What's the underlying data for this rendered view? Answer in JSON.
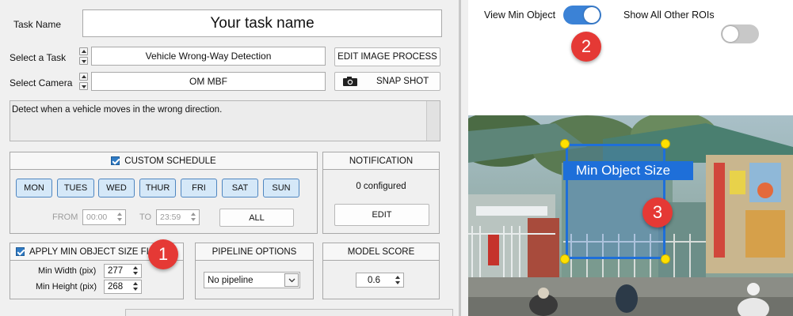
{
  "task": {
    "name_label": "Task Name",
    "name_value": "Your task name",
    "select_task_label": "Select a Task",
    "select_task_value": "Vehicle Wrong-Way Detection",
    "select_camera_label": "Select Camera",
    "select_camera_value": "OM MBF",
    "edit_image_process_label": "EDIT IMAGE PROCESS",
    "snapshot_label": "SNAP SHOT",
    "description": "Detect when a vehicle moves in the wrong direction."
  },
  "schedule": {
    "title": "CUSTOM SCHEDULE",
    "days": [
      "MON",
      "TUES",
      "WED",
      "THUR",
      "FRI",
      "SAT",
      "SUN"
    ],
    "from_label": "FROM",
    "from_value": "00:00",
    "to_label": "TO",
    "to_value": "23:59",
    "all_label": "ALL"
  },
  "notification": {
    "title": "NOTIFICATION",
    "status": "0 configured",
    "edit_label": "EDIT"
  },
  "min_object": {
    "title": "APPLY MIN OBJECT SIZE FILT",
    "width_label": "Min Width (pix)",
    "width_value": "277",
    "height_label": "Min Height (pix)",
    "height_value": "268"
  },
  "pipeline": {
    "title": "PIPELINE OPTIONS",
    "value": "No pipeline"
  },
  "model_score": {
    "title": "MODEL SCORE",
    "value": "0.6"
  },
  "viewer": {
    "view_min_object_label": "View Min Object",
    "view_min_object_on": true,
    "show_all_rois_label": "Show All Other ROIs",
    "show_all_rois_on": false,
    "overlay_label": "Min Object Size"
  },
  "callouts": [
    "1",
    "2",
    "3"
  ],
  "colors": {
    "accent": "#2f7bc5",
    "toggle_on": "#3b82d6",
    "toggle_off": "#c8c8c8",
    "callout": "#e53935",
    "roi": "#1e6fd9",
    "handle": "#ffe000"
  }
}
